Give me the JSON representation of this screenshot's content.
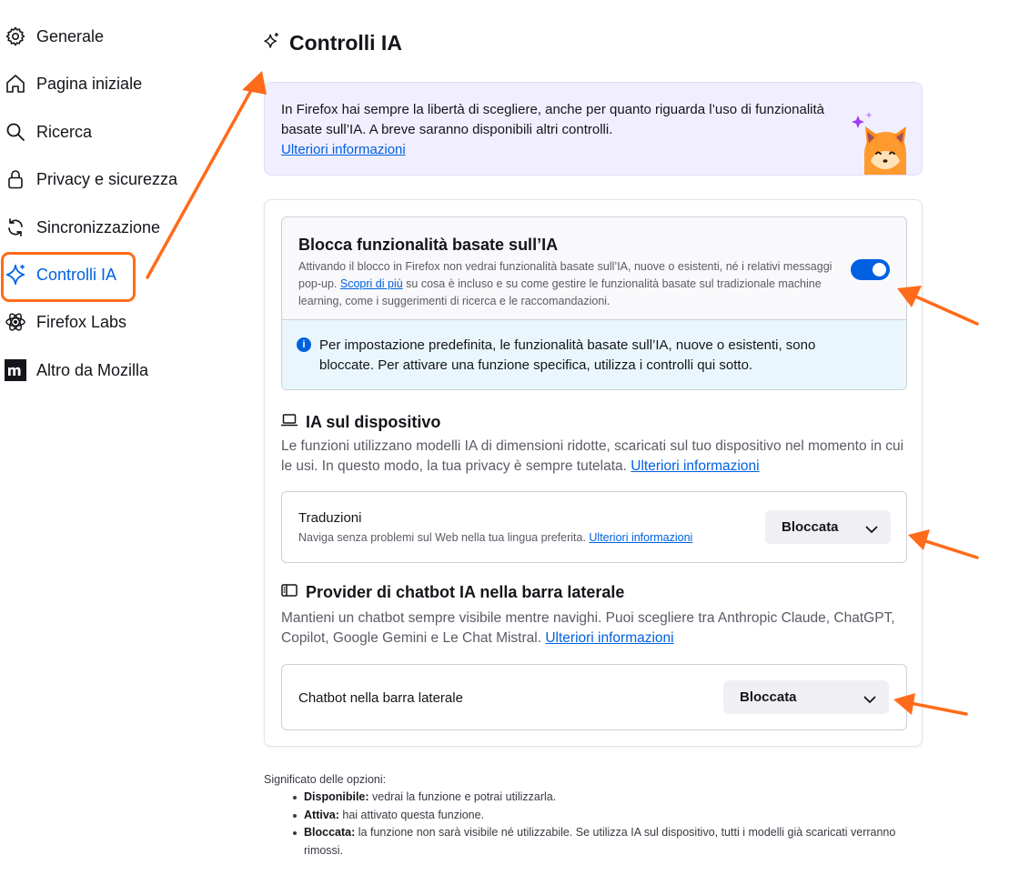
{
  "sidebar": {
    "items": [
      {
        "label": "Generale",
        "icon": "gear-icon"
      },
      {
        "label": "Pagina iniziale",
        "icon": "home-icon"
      },
      {
        "label": "Ricerca",
        "icon": "search-icon"
      },
      {
        "label": "Privacy e sicurezza",
        "icon": "lock-icon"
      },
      {
        "label": "Sincronizzazione",
        "icon": "sync-icon"
      },
      {
        "label": "Controlli IA",
        "icon": "sparkle-icon",
        "active": true
      },
      {
        "label": "Firefox Labs",
        "icon": "atom-icon"
      },
      {
        "label": "Altro da Mozilla",
        "icon": "mozilla-m-icon"
      }
    ]
  },
  "header": {
    "title": "Controlli IA"
  },
  "banner": {
    "text": "In Firefox hai sempre la libertà di scegliere, anche per quanto riguarda l’uso di funzionalità basate sull’IA. A breve saranno disponibili altri controlli.",
    "link": "Ulteriori informazioni"
  },
  "block": {
    "title": "Blocca funzionalità basate sull’IA",
    "desc_before": "Attivando il blocco in Firefox non vedrai funzionalità basate sull’IA, nuove o esistenti, né i relativi messaggi pop-up.",
    "desc_link": "Scopri di più",
    "desc_after": "su cosa è incluso e su come gestire le funzionalità basate sul tradizionale machine learning, come i suggerimenti di ricerca e le raccomandazioni.",
    "toggle_on": true,
    "info": "Per impostazione predefinita, le funzionalità basate sull’IA, nuove o esistenti, sono bloccate. Per attivare una funzione specifica, utilizza i controlli qui sotto."
  },
  "on_device": {
    "title": "IA sul dispositivo",
    "desc": "Le funzioni utilizzano modelli IA di dimensioni ridotte, scaricati sul tuo dispositivo nel momento in cui le usi. In questo modo, la tua privacy è sempre tutelata.",
    "link": "Ulteriori informazioni",
    "row_title": "Traduzioni",
    "row_desc": "Naviga senza problemi sul Web nella tua lingua preferita.",
    "row_link": "Ulteriori informazioni",
    "select_value": "Bloccata"
  },
  "chatbot": {
    "title": "Provider di chatbot IA nella barra laterale",
    "desc": "Mantieni un chatbot sempre visibile mentre navighi. Puoi scegliere tra Anthropic Claude, ChatGPT, Copilot, Google Gemini e Le Chat Mistral.",
    "link": "Ulteriori informazioni",
    "row_title": "Chatbot nella barra laterale",
    "select_value": "Bloccata"
  },
  "legend": {
    "title": "Significato delle opzioni:",
    "items": [
      {
        "term": "Disponibile:",
        "text": "vedrai la funzione e potrai utilizzarla."
      },
      {
        "term": "Attiva:",
        "text": "hai attivato questa funzione."
      },
      {
        "term": "Bloccata:",
        "text": "la funzione non sarà visibile né utilizzabile. Se utilizza IA sul dispositivo, tutti i modelli già scaricati verranno rimossi."
      }
    ]
  },
  "colors": {
    "accent": "#0061e0",
    "annotation": "#ff6b1a",
    "banner_bg": "#f1efff",
    "info_bg": "#e9f7fd"
  }
}
